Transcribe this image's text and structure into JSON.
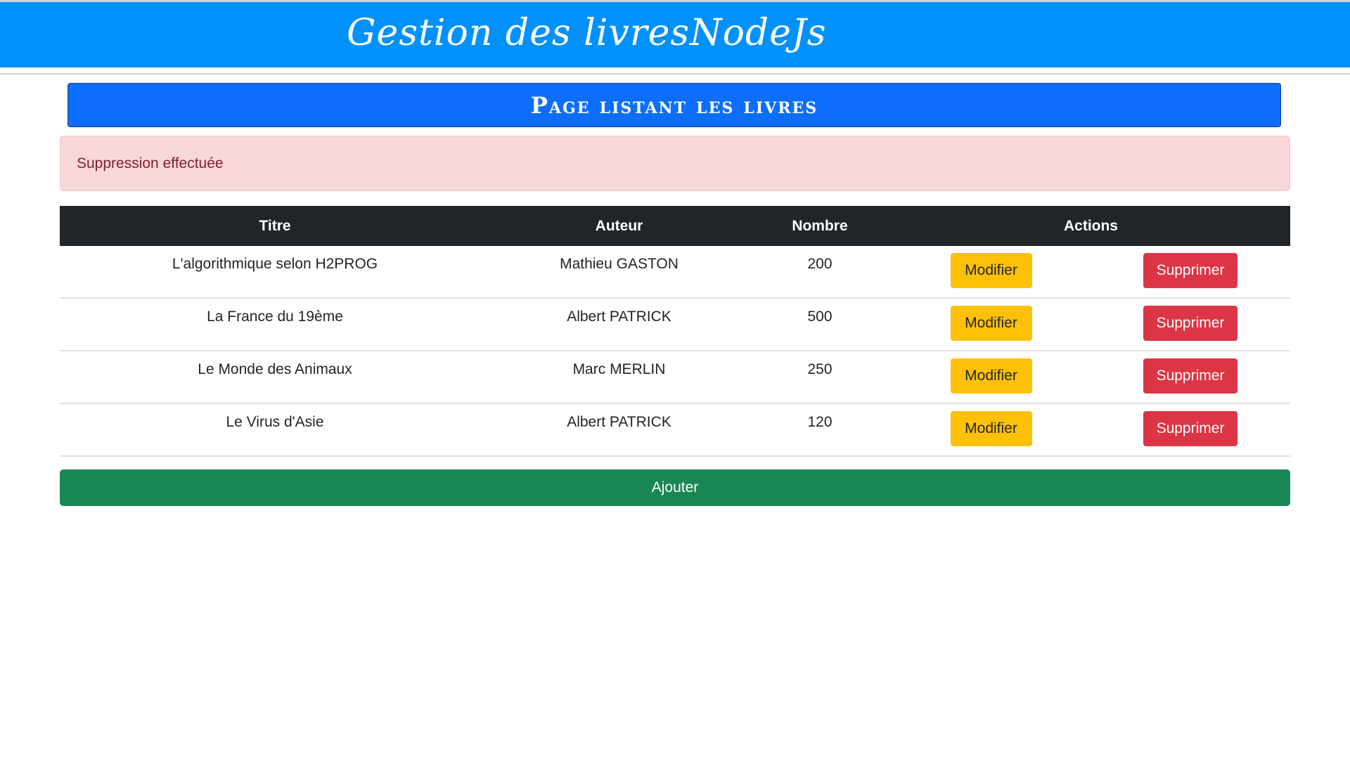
{
  "header": {
    "site_title": "Gestion des livresNodeJs"
  },
  "page": {
    "heading": "Page listant les livres"
  },
  "alert": {
    "message": "Suppression effectuée"
  },
  "table": {
    "columns": {
      "titre": "Titre",
      "auteur": "Auteur",
      "nombre": "Nombre",
      "actions": "Actions"
    },
    "rows": [
      {
        "titre": "L'algorithmique selon H2PROG",
        "auteur": "Mathieu GASTON",
        "nombre": "200"
      },
      {
        "titre": "La France du 19ème",
        "auteur": "Albert PATRICK",
        "nombre": "500"
      },
      {
        "titre": "Le Monde des Animaux",
        "auteur": "Marc MERLIN",
        "nombre": "250"
      },
      {
        "titre": "Le Virus d'Asie",
        "auteur": "Albert PATRICK",
        "nombre": "120"
      }
    ],
    "edit_label": "Modifier",
    "delete_label": "Supprimer"
  },
  "actions": {
    "add_label": "Ajouter"
  },
  "colors": {
    "banner": "#0191fd",
    "heading": "#0d6efd",
    "alert_bg": "#f8d7da",
    "alert_text": "#842029",
    "table_header": "#212529",
    "edit_button": "#ffc107",
    "delete_button": "#dc3545",
    "add_button": "#198754"
  }
}
